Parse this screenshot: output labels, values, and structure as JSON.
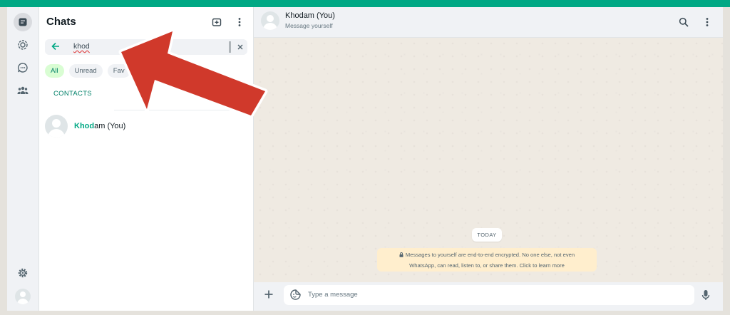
{
  "sidebar": {
    "title": "Chats",
    "search": {
      "value": "khod"
    },
    "filters": [
      "All",
      "Unread",
      "Fav"
    ],
    "section_label": "CONTACTS",
    "contact": {
      "match": "Khod",
      "rest": "am (You)"
    }
  },
  "conversation": {
    "name": "Khodam (You)",
    "subtitle": "Message yourself",
    "date_label": "TODAY",
    "notice_line1": "Messages to yourself are end-to-end encrypted. No one else, not even",
    "notice_line2": "WhatsApp, can read, listen to, or share them. Click to learn more",
    "input_placeholder": "Type a message"
  },
  "colors": {
    "accent": "#00a884",
    "annotation_arrow": "#d0392b"
  }
}
